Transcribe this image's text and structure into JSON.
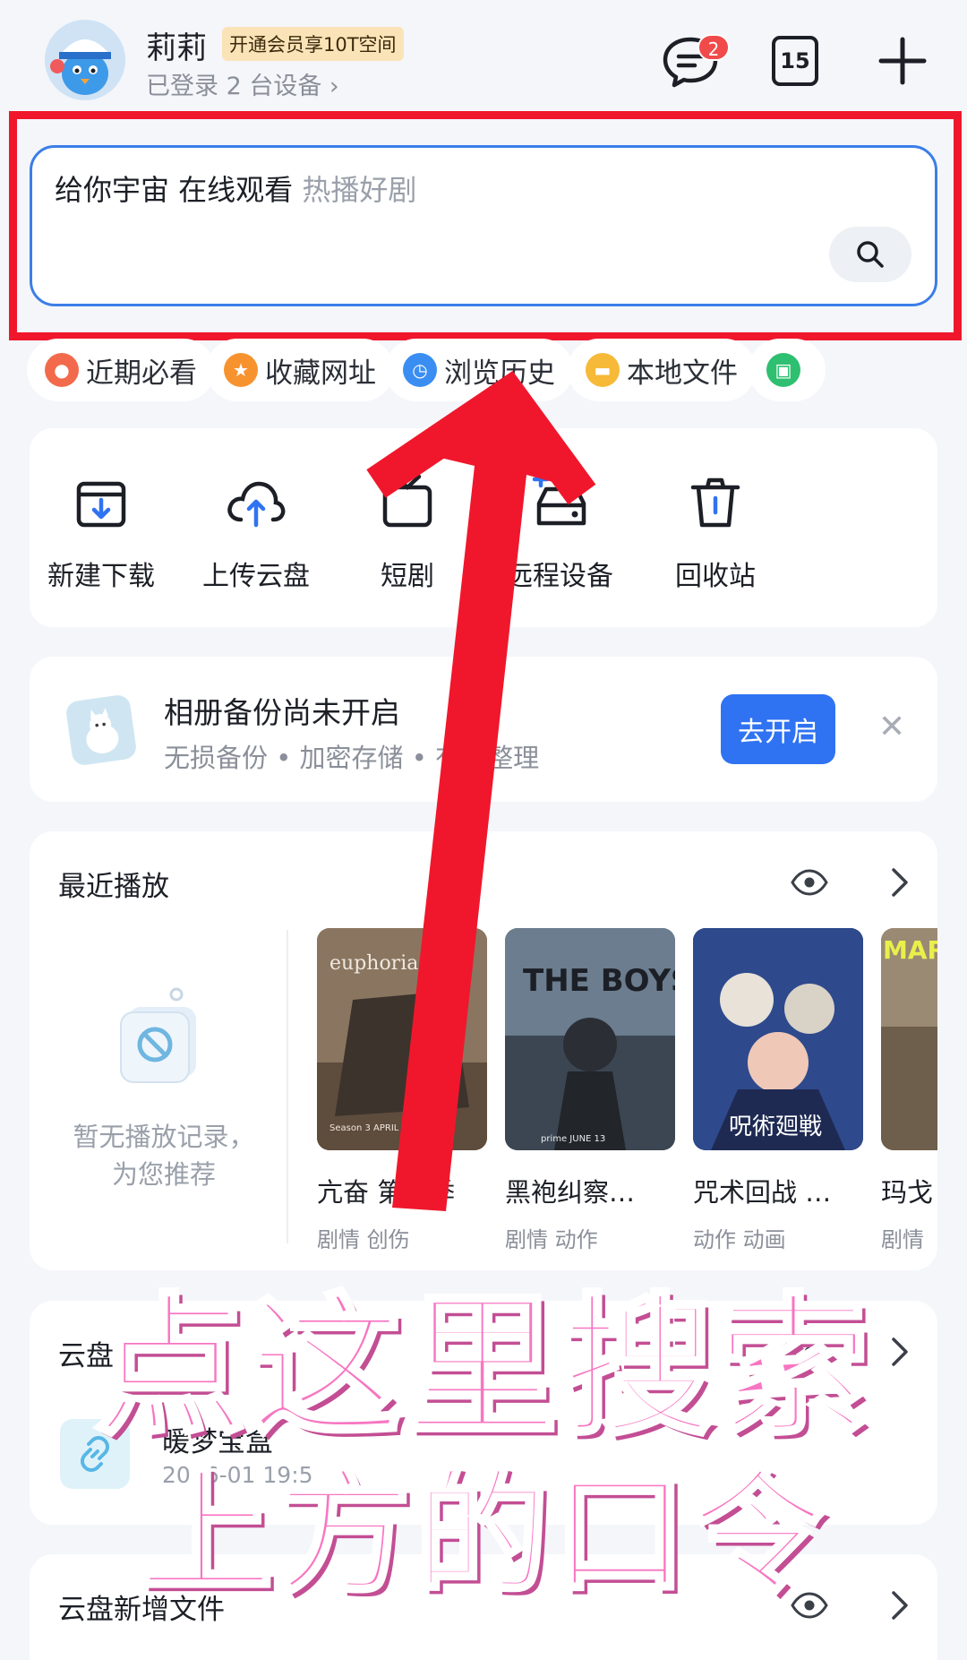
{
  "header": {
    "user_name": "莉莉",
    "vip_badge": "开通会员享10T空间",
    "devices": "已登录 2 台设备 ›",
    "message_count": "2",
    "calendar_day": "15"
  },
  "search": {
    "query": "给你宇宙 在线观看",
    "hint": "热播好剧"
  },
  "chips": [
    {
      "label": "近期必看",
      "color": "#f26a4b"
    },
    {
      "label": "收藏网址",
      "color": "#f7932e"
    },
    {
      "label": "浏览历史",
      "color": "#3a8ef2"
    },
    {
      "label": "本地文件",
      "color": "#f7b938"
    },
    {
      "label": "",
      "color": "#2fbf71"
    }
  ],
  "tools": [
    {
      "label": "新建下载",
      "icon": "download-box-icon"
    },
    {
      "label": "上传云盘",
      "icon": "cloud-upload-icon"
    },
    {
      "label": "短剧",
      "icon": "short-drama-icon"
    },
    {
      "label": "远程设备",
      "icon": "remote-device-icon"
    },
    {
      "label": "回收站",
      "icon": "trash-icon"
    }
  ],
  "backup": {
    "title": "相册备份尚未开启",
    "subtitle": "无损备份 • 加密存储 • 有序整理",
    "button": "去开启",
    "close": "✕"
  },
  "recent": {
    "title": "最近播放",
    "empty_text": "暂无播放记录，为您推荐",
    "items": [
      {
        "title": "亢奋 第三季",
        "tags": "剧情 创伤",
        "poster_text": "euphoria",
        "poster_sub": "Season 3 APRIL 2026",
        "bg": "#7a6a58"
      },
      {
        "title": "黑袍纠察…",
        "tags": "剧情 动作",
        "poster_text": "THE BOYS",
        "poster_sub": "prime JUNE 13",
        "bg": "#5d6f80"
      },
      {
        "title": "咒术回战 …",
        "tags": "动作 动画",
        "poster_text": "呪術廻戦",
        "poster_sub": "",
        "bg": "#2c3f7a"
      },
      {
        "title": "玛戈",
        "tags": "剧情",
        "poster_text": "MAR GOT TRO",
        "poster_sub": "",
        "bg": "#8a7a66"
      }
    ]
  },
  "cloud": {
    "title": "云盘",
    "file_name": "暖梦宝盒",
    "file_date": "2026-01 19:5"
  },
  "newfiles": {
    "title": "云盘新增文件"
  },
  "overlay": {
    "line1": "点这里搜索",
    "line2": "上方的口令"
  }
}
